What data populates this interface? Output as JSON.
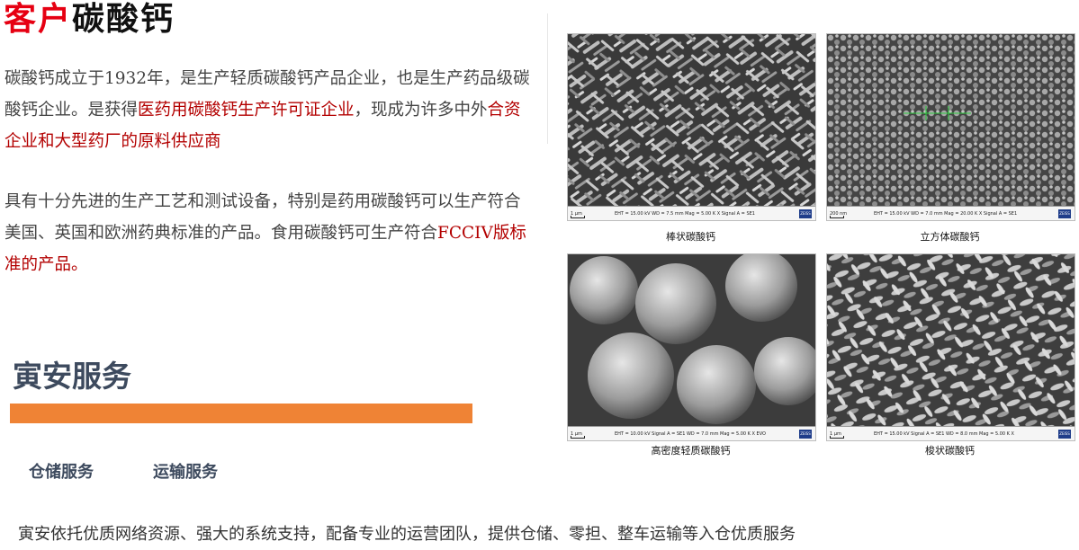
{
  "header": {
    "title_red": "客户",
    "title_black": "碳酸钙"
  },
  "intro": {
    "p1_a": "碳酸钙成立于1932年，是生产轻质碳酸钙产品企业，也是生产药品级碳酸钙企业。是获得",
    "p1_b": "医药用碳酸钙生产许可证企业",
    "p1_c": "，现成为许多中外",
    "p1_d": "合资企业和大型药厂的原料供应商",
    "p2_a": "具有十分先进的生产工艺和测试设备，特别是",
    "p2_b": "药用碳酸钙",
    "p2_c": "可以生产符合美国、英国和欧洲药典标准的产品。食用碳酸钙可生产符合",
    "p2_d": "FCCIV版标准的产品。"
  },
  "services": {
    "title": "寅安服务",
    "tabs": [
      "仓储服务",
      "运输服务"
    ],
    "description": "寅安依托优质网络资源、强大的系统支持，配备专业的运营团队，提供仓储、零担、整车运输等入仓优质服务"
  },
  "micrographs": [
    {
      "caption": "棒状碳酸钙",
      "scale": "1 μm",
      "meta": "EHT = 15.00 kV    WD = 7.5 mm    Mag = 5.00 K X    Signal A = SE1"
    },
    {
      "caption": "立方体碳酸钙",
      "scale": "200 nm",
      "meta": "EHT = 15.00 kV    WD = 7.0 mm    Mag = 20.00 K X    Signal A = SE1"
    },
    {
      "caption": "高密度轻质碳酸钙",
      "scale": "1 μm",
      "meta": "EHT = 10.00 kV    Signal A = SE1    WD = 7.0 mm    Mag = 5.00 K X    EVO"
    },
    {
      "caption": "梭状碳酸钙",
      "scale": "1 μm",
      "meta": "EHT = 15.00 kV    Signal A = SE1    WD = 8.0 mm    Mag = 5.00 K X"
    }
  ],
  "colors": {
    "red": "#e60012",
    "highlight": "#b30000",
    "orange": "#ef8335",
    "navy": "#3d4a5e"
  }
}
